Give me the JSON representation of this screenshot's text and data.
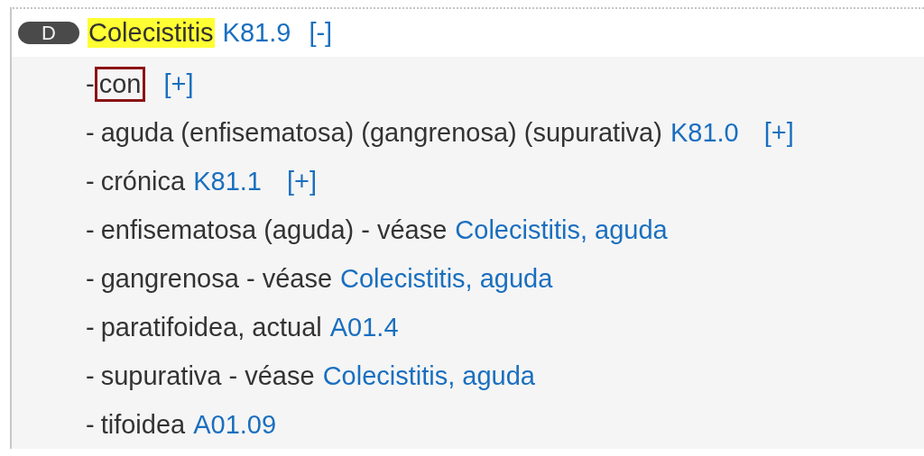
{
  "entry": {
    "badge": "D",
    "term": "Colecistitis",
    "term_highlighted": true,
    "code": "K81.9",
    "toggle": "[-]",
    "expanded": true
  },
  "subterms": [
    {
      "dash": "-",
      "text": "con",
      "boxed": true,
      "toggle": "[+]"
    },
    {
      "dash": "-",
      "text": "aguda (enfisematosa) (gangrenosa) (supurativa)",
      "boxed": false,
      "code": "K81.0",
      "toggle": "[+]"
    },
    {
      "dash": "-",
      "text": "crónica",
      "boxed": false,
      "code": "K81.1",
      "toggle": "[+]"
    },
    {
      "dash": "-",
      "text": "enfisematosa (aguda) - véase",
      "boxed": false,
      "see": "Colecistitis, aguda"
    },
    {
      "dash": "-",
      "text": "gangrenosa - véase",
      "boxed": false,
      "see": "Colecistitis, aguda"
    },
    {
      "dash": "-",
      "text": "paratifoidea, actual",
      "boxed": false,
      "code": "A01.4"
    },
    {
      "dash": "-",
      "text": "supurativa - véase",
      "boxed": false,
      "see": "Colecistitis, aguda"
    },
    {
      "dash": "-",
      "text": "tifoidea",
      "boxed": false,
      "code": "A01.09"
    }
  ]
}
